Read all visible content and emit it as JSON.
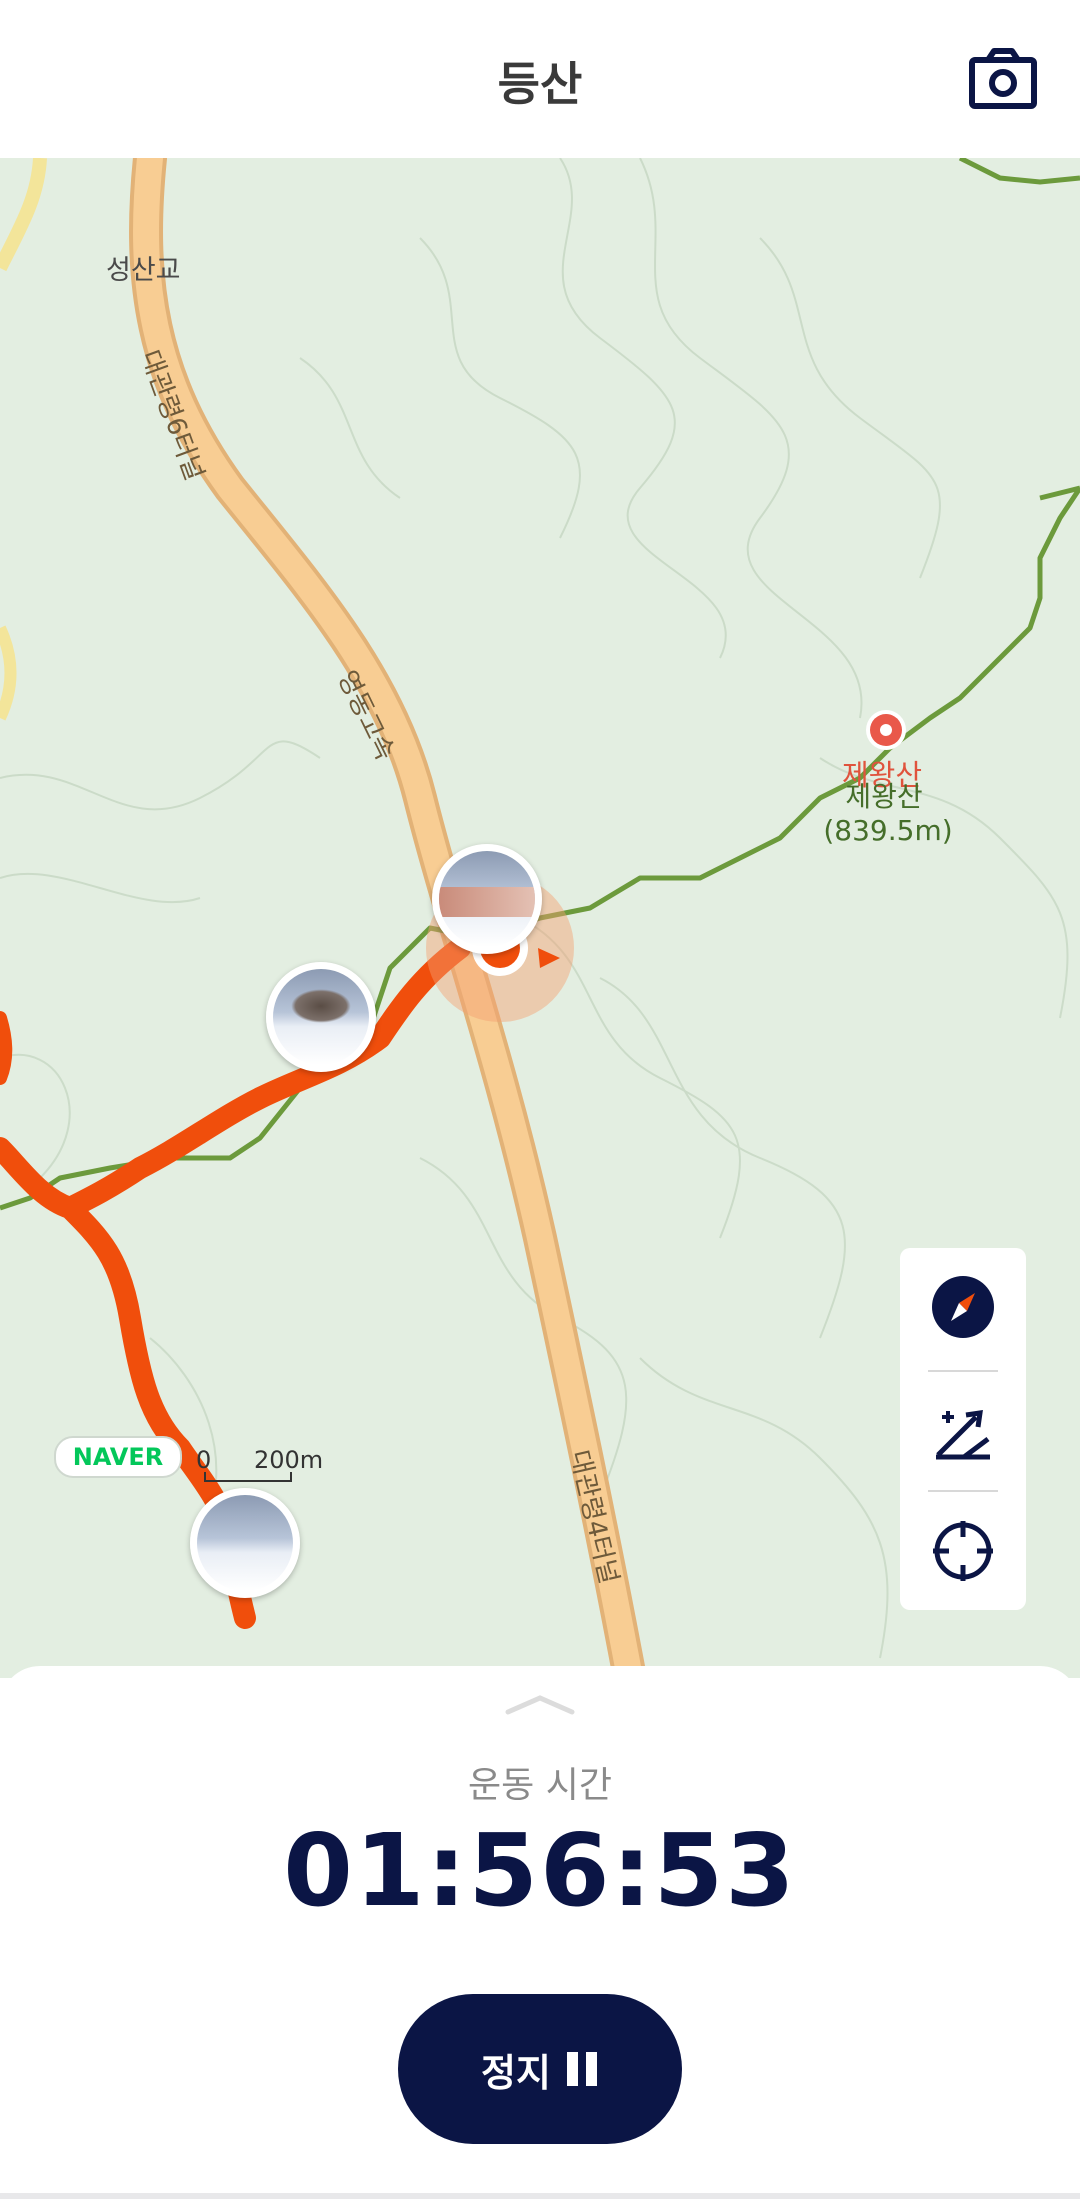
{
  "header": {
    "title": "등산",
    "camera_icon": "camera-icon"
  },
  "map": {
    "places": {
      "seongsangyo": "성산교",
      "peak_red": "제왕산",
      "peak_green": "제왕산",
      "peak_elevation": "(839.5m)"
    },
    "roads": {
      "tunnel6": "대관령6터널",
      "expressway": "영동고속",
      "tunnel4": "대관령4터널"
    },
    "provider": "NAVER",
    "scale": {
      "zero": "0",
      "label": "200m"
    },
    "colors": {
      "route": "#f04e0c",
      "trail": "#6c9a3c",
      "road": "#f7c98c",
      "background": "#e3eee1"
    }
  },
  "map_controls": {
    "compass": "compass-icon",
    "elevation": "elevation-icon",
    "locate": "crosshair-icon"
  },
  "sheet": {
    "handle_icon": "chevron-up-icon",
    "label": "운동 시간",
    "time": "01:56:53",
    "stop_label": "정지",
    "pause_icon": "pause-icon",
    "accent": "#0b1545"
  }
}
